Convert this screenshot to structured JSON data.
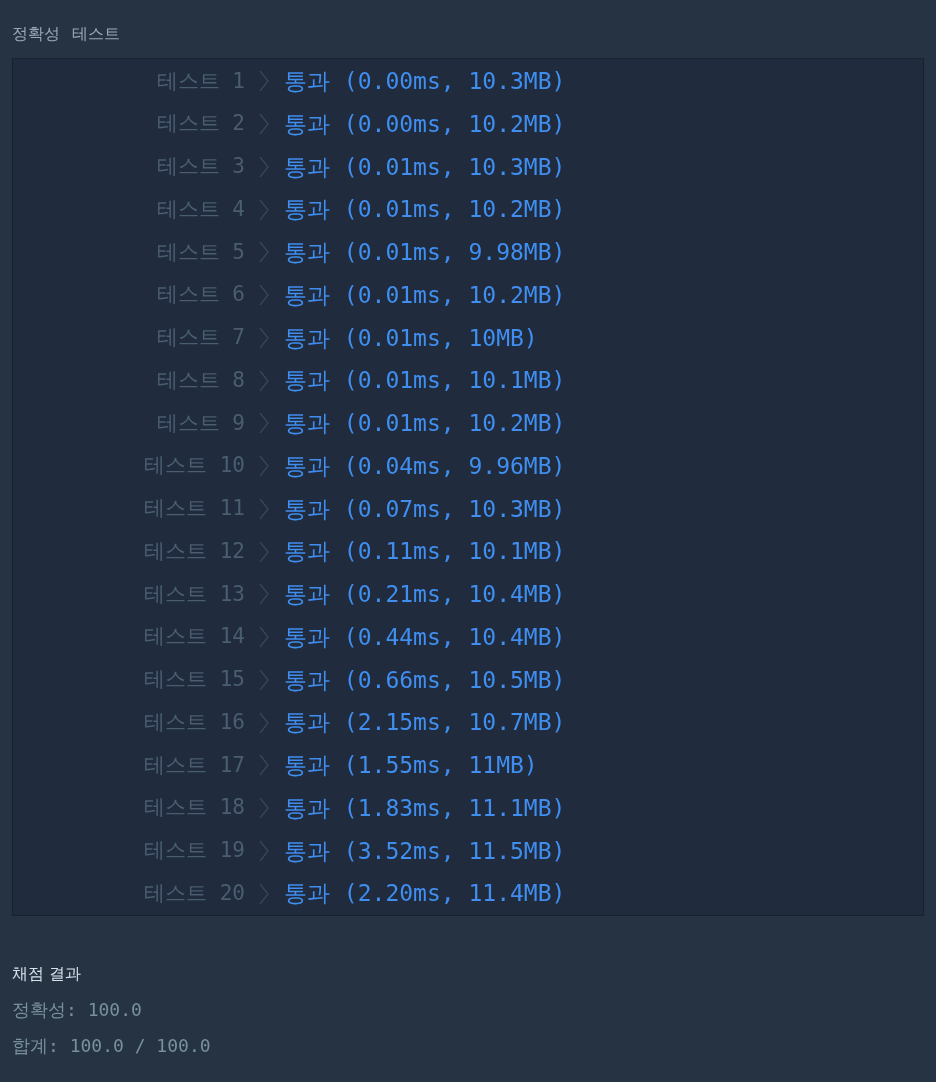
{
  "section_title": [
    "정확성",
    "테스트"
  ],
  "results": [
    {
      "label": "테스트 1",
      "kind": "pass",
      "result": "통과 (0.00ms, 10.3MB)"
    },
    {
      "label": "테스트 2",
      "kind": "pass",
      "result": "통과 (0.00ms, 10.2MB)"
    },
    {
      "label": "테스트 3",
      "kind": "pass",
      "result": "통과 (0.01ms, 10.3MB)"
    },
    {
      "label": "테스트 4",
      "kind": "pass",
      "result": "통과 (0.01ms, 10.2MB)"
    },
    {
      "label": "테스트 5",
      "kind": "pass",
      "result": "통과 (0.01ms, 9.98MB)"
    },
    {
      "label": "테스트 6",
      "kind": "pass",
      "result": "통과 (0.01ms, 10.2MB)"
    },
    {
      "label": "테스트 7",
      "kind": "pass",
      "result": "통과 (0.01ms, 10MB)"
    },
    {
      "label": "테스트 8",
      "kind": "pass",
      "result": "통과 (0.01ms, 10.1MB)"
    },
    {
      "label": "테스트 9",
      "kind": "pass",
      "result": "통과 (0.01ms, 10.2MB)"
    },
    {
      "label": "테스트 10",
      "kind": "pass",
      "result": "통과 (0.04ms, 9.96MB)"
    },
    {
      "label": "테스트 11",
      "kind": "pass",
      "result": "통과 (0.07ms, 10.3MB)"
    },
    {
      "label": "테스트 12",
      "kind": "pass",
      "result": "통과 (0.11ms, 10.1MB)"
    },
    {
      "label": "테스트 13",
      "kind": "pass",
      "result": "통과 (0.21ms, 10.4MB)"
    },
    {
      "label": "테스트 14",
      "kind": "pass",
      "result": "통과 (0.44ms, 10.4MB)"
    },
    {
      "label": "테스트 15",
      "kind": "pass",
      "result": "통과 (0.66ms, 10.5MB)"
    },
    {
      "label": "테스트 16",
      "kind": "pass",
      "result": "통과 (2.15ms, 10.7MB)"
    },
    {
      "label": "테스트 17",
      "kind": "pass",
      "result": "통과 (1.55ms, 11MB)"
    },
    {
      "label": "테스트 18",
      "kind": "pass",
      "result": "통과 (1.83ms, 11.1MB)"
    },
    {
      "label": "테스트 19",
      "kind": "pass",
      "result": "통과 (3.52ms, 11.5MB)"
    },
    {
      "label": "테스트 20",
      "kind": "pass",
      "result": "통과 (2.20ms, 11.4MB)"
    }
  ],
  "grading": {
    "title": "채점 결과",
    "lines": [
      "정확성: 100.0",
      "합계: 100.0 / 100.0"
    ]
  }
}
